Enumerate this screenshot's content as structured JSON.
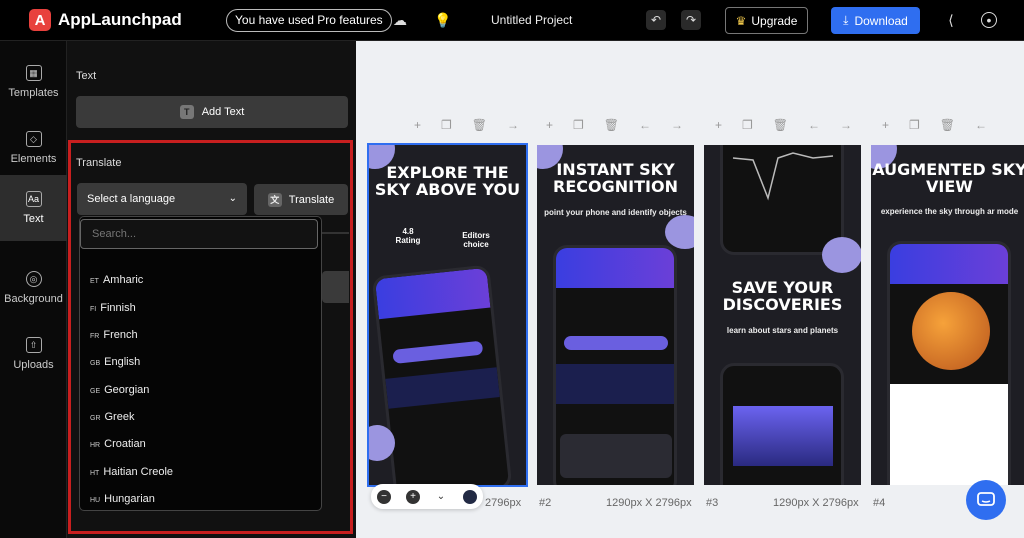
{
  "app": {
    "name": "AppLaunchpad",
    "logo_letter": "A"
  },
  "topbar": {
    "pro_notice": "You have used Pro features",
    "project_title": "Untitled Project",
    "upgrade_label": "Upgrade",
    "download_label": "Download"
  },
  "sidebar": {
    "items": [
      {
        "label": "Templates",
        "icon": "grid-icon"
      },
      {
        "label": "Elements",
        "icon": "shapes-icon"
      },
      {
        "label": "Text",
        "icon": "text-icon"
      },
      {
        "label": "Background",
        "icon": "palette-icon"
      },
      {
        "label": "Uploads",
        "icon": "upload-icon"
      }
    ]
  },
  "panel": {
    "text_heading": "Text",
    "add_text_label": "Add Text",
    "translate_heading": "Translate",
    "select_placeholder": "Select a language",
    "translate_button": "Translate",
    "search_placeholder": "Search...",
    "languages": [
      {
        "code": "ET",
        "name": "Amharic"
      },
      {
        "code": "FI",
        "name": "Finnish"
      },
      {
        "code": "FR",
        "name": "French"
      },
      {
        "code": "GB",
        "name": "English"
      },
      {
        "code": "GE",
        "name": "Georgian"
      },
      {
        "code": "GR",
        "name": "Greek"
      },
      {
        "code": "HR",
        "name": "Croatian"
      },
      {
        "code": "HT",
        "name": "Haitian Creole"
      },
      {
        "code": "HU",
        "name": "Hungarian"
      }
    ]
  },
  "screens": [
    {
      "headline": "EXPLORE THE SKY ABOVE YOU",
      "rating": "4.8",
      "rating_label": "Rating",
      "badge": "Editors choice",
      "size": "2796px"
    },
    {
      "headline": "INSTANT SKY RECOGNITION",
      "subline": "point your phone and identify objects",
      "number": "#2",
      "size": "1290px X 2796px"
    },
    {
      "headline": "SAVE YOUR DISCOVERIES",
      "subline": "learn about stars and planets",
      "number": "#3",
      "size": "1290px X 2796px"
    },
    {
      "headline": "AUGMENTED SKY VIEW",
      "subline": "experience the sky through ar mode",
      "number": "#4",
      "size": "1290px X 2796px"
    }
  ],
  "colors": {
    "accent": "#2f6ef0",
    "brand": "#e8413d",
    "highlight_frame": "#c81f1f"
  }
}
